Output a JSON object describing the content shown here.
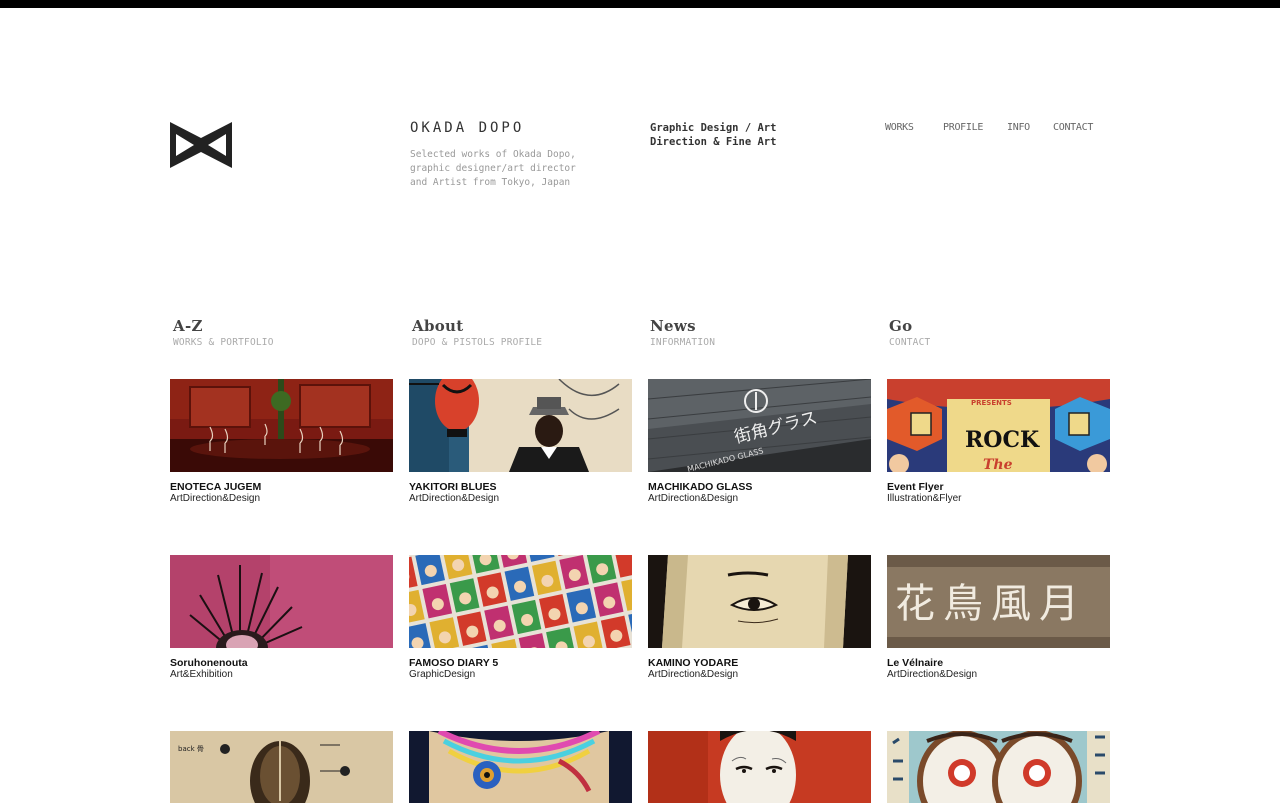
{
  "header": {
    "site_title": "OKADA DOPO",
    "description": "Selected works of Okada Dopo, graphic designer/art director and Artist from Tokyo, Japan",
    "tagline": "Graphic Design / Art Direction & Fine Art"
  },
  "nav": {
    "works": "WORKS",
    "profile": "PROFILE",
    "info": "INFO",
    "contact": "CONTACT"
  },
  "sections": [
    {
      "title": "A-Z",
      "subtitle": "WORKS & PORTFOLIO"
    },
    {
      "title": "About",
      "subtitle": "DOPO & PISTOLS PROFILE"
    },
    {
      "title": "News",
      "subtitle": "INFORMATION"
    },
    {
      "title": "Go",
      "subtitle": "CONTACT"
    }
  ],
  "works": [
    {
      "title": "ENOTECA JUGEM",
      "category": "ArtDirection&Design"
    },
    {
      "title": "YAKITORI BLUES",
      "category": "ArtDirection&Design"
    },
    {
      "title": "MACHIKADO GLASS",
      "category": "ArtDirection&Design"
    },
    {
      "title": "Event Flyer",
      "category": "Illustration&Flyer"
    },
    {
      "title": "Soruhonenouta",
      "category": "Art&Exhibition"
    },
    {
      "title": "FAMOSO DIARY 5",
      "category": "GraphicDesign"
    },
    {
      "title": "KAMINO YODARE",
      "category": "ArtDirection&Design"
    },
    {
      "title": "Le Vélnaire",
      "category": "ArtDirection&Design"
    },
    {
      "title": "",
      "category": ""
    },
    {
      "title": "",
      "category": ""
    },
    {
      "title": "",
      "category": ""
    },
    {
      "title": "",
      "category": ""
    }
  ],
  "thumb_text": {
    "machikado_sign": "街角グラス",
    "machikado_latin": "MACHIKADO GLASS",
    "flyer_top": "PRESENTS",
    "flyer_main": "ROCK",
    "flyer_sub": "The",
    "velnaire_kanji": "花鳥風月",
    "anatomy_label": "back 骨"
  },
  "colors": {
    "top_bar": "#000000",
    "text_dark": "#333333",
    "text_muted": "#999999"
  }
}
